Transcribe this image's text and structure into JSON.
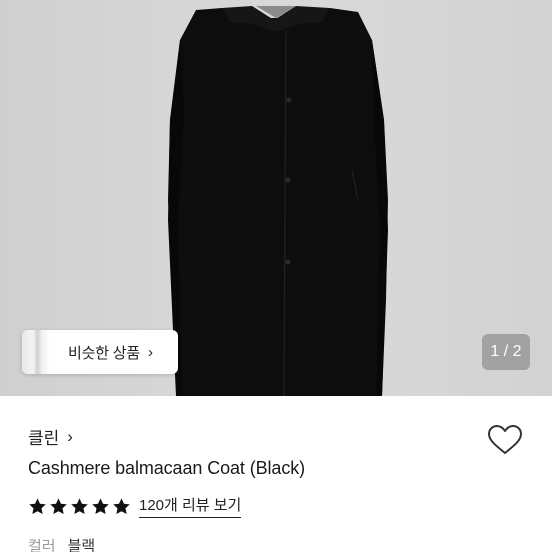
{
  "hero": {
    "similar_button": {
      "label": "비슷한 상품",
      "chevron": "›"
    },
    "page_indicator": "1 / 2"
  },
  "product": {
    "brand": "클린",
    "brand_chevron": "›",
    "title": "Cashmere balmacaan Coat (Black)",
    "rating": {
      "stars": 5,
      "review_text": "120개 리뷰 보기"
    },
    "option": {
      "label": "컬러",
      "value": "블랙"
    }
  },
  "colors": {
    "star": "#111111",
    "coat": "#0b0b0b",
    "background": "#d4d4d4"
  },
  "icons": [
    "heart-icon",
    "star-icon",
    "chevron-right-icon"
  ]
}
